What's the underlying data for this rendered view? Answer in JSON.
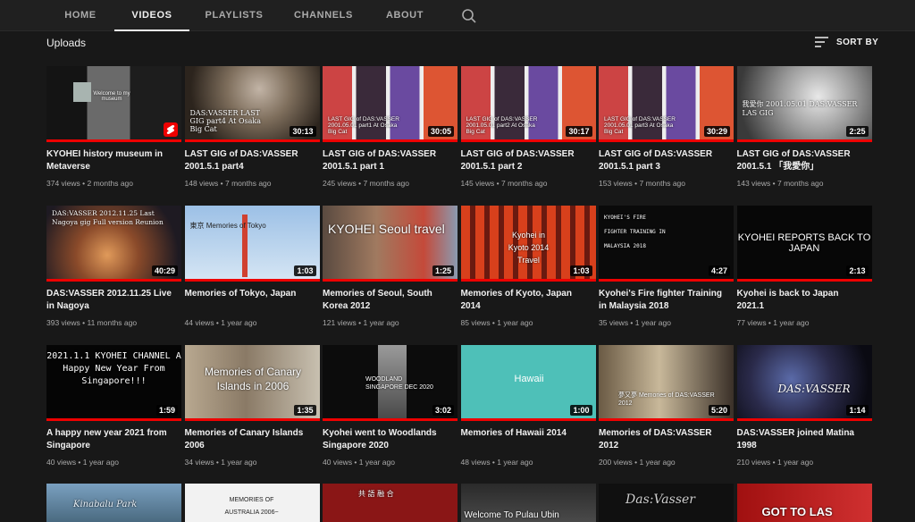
{
  "tabs": [
    {
      "label": "HOME"
    },
    {
      "label": "VIDEOS"
    },
    {
      "label": "PLAYLISTS"
    },
    {
      "label": "CHANNELS"
    },
    {
      "label": "ABOUT"
    }
  ],
  "section": {
    "title": "Uploads",
    "sort_label": "SORT BY"
  },
  "videos": [
    {
      "title": "KYOHEI history museum in Metaverse",
      "meta": "374 views • 2 months ago",
      "duration": "",
      "thumb_text": "Welcome to my museum"
    },
    {
      "title": "LAST GIG of DAS:VASSER 2001.5.1 part4",
      "meta": "148 views • 7 months ago",
      "duration": "30:13",
      "thumb_text": "DAS:VASSER LAST GIG part4 At Osaka Big Cat"
    },
    {
      "title": "LAST GIG of DAS:VASSER 2001.5.1 part 1",
      "meta": "245 views • 7 months ago",
      "duration": "30:05",
      "thumb_text": "LAST GIG of DAS:VASSER 2001.05.01 part1 At Osaka Big Cat"
    },
    {
      "title": "LAST GIG of DAS:VASSER 2001.5.1 part 2",
      "meta": "145 views • 7 months ago",
      "duration": "30:17",
      "thumb_text": "LAST GIG of DAS:VASSER 2001.05.01 part2 At Osaka Big Cat"
    },
    {
      "title": "LAST GIG of DAS:VASSER 2001.5.1 part 3",
      "meta": "153 views • 7 months ago",
      "duration": "30:29",
      "thumb_text": "LAST GIG of DAS:VASSER 2001.05.01 part3 At Osaka Big Cat"
    },
    {
      "title": "LAST GIG of DAS:VASSER 2001.5.1 「我愛你」",
      "meta": "143 views • 7 months ago",
      "duration": "2:25",
      "thumb_text": "我愛你 2001.05.01 DAS:VASSER LAS GIG"
    },
    {
      "title": "DAS:VASSER 2012.11.25 Live in Nagoya",
      "meta": "393 views • 11 months ago",
      "duration": "40:29",
      "thumb_text": "DAS:VASSER 2012.11.25 Last Nagoya gig Full version Reunion"
    },
    {
      "title": "Memories of Tokyo, Japan",
      "meta": "44 views • 1 year ago",
      "duration": "1:03",
      "thumb_text": "東京 Memories of Tokyo"
    },
    {
      "title": "Memories of Seoul, South Korea 2012",
      "meta": "121 views • 1 year ago",
      "duration": "1:25",
      "thumb_text": "KYOHEI Seoul travel"
    },
    {
      "title": "Memories of Kyoto, Japan 2014",
      "meta": "85 views • 1 year ago",
      "duration": "1:03",
      "thumb_text": "Kyohei in Kyoto 2014 Travel"
    },
    {
      "title": "Kyohei's Fire fighter Training in Malaysia 2018",
      "meta": "35 views • 1 year ago",
      "duration": "4:27",
      "thumb_text": "KYOHEI'S FIRE FIGHTER TRAINING IN MALAYSIA 2018"
    },
    {
      "title": "Kyohei is back to Japan 2021.1",
      "meta": "77 views • 1 year ago",
      "duration": "2:13",
      "thumb_text": "KYOHEI REPORTS BACK TO JAPAN"
    },
    {
      "title": "A happy new year 2021 from Singapore",
      "meta": "40 views • 1 year ago",
      "duration": "1:59",
      "thumb_text": "2021.1.1 KYOHEI CHANNEL A Happy New Year From Singapore!!!"
    },
    {
      "title": "Memories of Canary Islands 2006",
      "meta": "34 views • 1 year ago",
      "duration": "1:35",
      "thumb_text": "Memories of Canary Islands in 2006"
    },
    {
      "title": "Kyohei went to Woodlands Singapore 2020",
      "meta": "40 views • 1 year ago",
      "duration": "3:02",
      "thumb_text": "WOODLAND SINGAPORE DEC 2020"
    },
    {
      "title": "Memories of Hawaii 2014",
      "meta": "48 views • 1 year ago",
      "duration": "1:00",
      "thumb_text": "Hawaii"
    },
    {
      "title": "Memories of DAS:VASSER 2012",
      "meta": "200 views • 1 year ago",
      "duration": "5:20",
      "thumb_text": "夢又夢 Memories of DAS:VASSER 2012"
    },
    {
      "title": "DAS:VASSER joined Matina 1998",
      "meta": "210 views • 1 year ago",
      "duration": "1:14",
      "thumb_text": "DAS:VASSER"
    }
  ],
  "partial_row": [
    {
      "thumb_text": "Kinabalu Park"
    },
    {
      "thumb_text": "MEMORIES OF AUSTRALIA 2006~"
    },
    {
      "thumb_text": "共 語 融 合"
    },
    {
      "thumb_text": "Welcome To Pulau Ubin"
    },
    {
      "thumb_text": "Das:Vasser"
    },
    {
      "thumb_text": "GOT TO LAS"
    }
  ],
  "colors": {
    "background": "#181818",
    "tab_bar": "#202020",
    "accent_red": "#ee0000",
    "text_primary": "#f1f1f1",
    "text_secondary": "#aaaaaa"
  },
  "icons": {
    "search": "search-icon",
    "sort": "sort-icon",
    "shorts": "shorts-badge-icon"
  }
}
